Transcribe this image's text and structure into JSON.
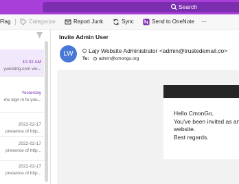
{
  "search": {
    "label": "Search"
  },
  "toolbar": {
    "flag_label": "Flag",
    "categorize_label": "Categorize",
    "report_junk_label": "Report Junk",
    "sync_label": "Sync",
    "send_onenote_label": "Send to OneNote",
    "more_label": "···"
  },
  "message_list": {
    "items": [
      {
        "date": "10:32 AM",
        "preview": "ywelding.com we...",
        "selected": true
      },
      {
        "date": "Yesterday",
        "preview": "ew sign-in to you..."
      },
      {
        "date": "2022-02-17",
        "preview": "presence of http..."
      },
      {
        "date": "2022-02-17",
        "preview": "presence of http..."
      },
      {
        "date": "2022-02-17",
        "preview": "presence of http..."
      }
    ]
  },
  "reading": {
    "subject": "Invite Admin User",
    "avatar_initials": "LW",
    "from": "Lajy Website Administrator <admin@trustedemail.co>",
    "to_label": "To:",
    "to_address": "admin@cmongo.org",
    "body_lines": [
      "Hello CmonGo,",
      "You've been invited as an",
      "website.",
      "Best regards."
    ]
  },
  "colors": {
    "accent": "#a93fd9",
    "search_bg": "#7b2fb0",
    "avatar": "#4a78d6",
    "onenote": "#7719aa",
    "selected_row": "#f1e9fb"
  }
}
